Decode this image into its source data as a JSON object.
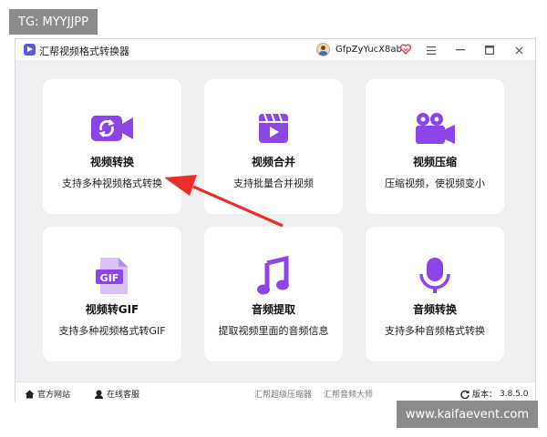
{
  "overlay_tag": "TG: MYYJJPP",
  "watermark": "www.kaifaevent.com",
  "window": {
    "title": "汇帮视频格式转换器",
    "user_name": "GfpZyYucX8ab"
  },
  "cards": [
    {
      "title": "视频转换",
      "desc": "支持多种视频格式转换",
      "icon": "video-convert-icon"
    },
    {
      "title": "视频合并",
      "desc": "支持批量合并视频",
      "icon": "clapperboard-icon"
    },
    {
      "title": "视频压缩",
      "desc": "压缩视频，使视频变小",
      "icon": "video-camera-icon"
    },
    {
      "title": "视频转GIF",
      "desc": "支持多种视频格式转GIF",
      "icon": "gif-file-icon"
    },
    {
      "title": "音频提取",
      "desc": "提取视频里面的音频信息",
      "icon": "music-note-icon"
    },
    {
      "title": "音频转换",
      "desc": "支持多种音频格式转换",
      "icon": "microphone-icon"
    }
  ],
  "footer": {
    "official_site": "官方网站",
    "online_service": "在线客服",
    "compress_master": "汇帮超级压缩器",
    "audio_master": "汇帮音频大师",
    "version_label": "版本：",
    "version_value": "3.8.5.0"
  },
  "colors": {
    "accent": "#8b45e8",
    "arrow": "#e8302a"
  }
}
